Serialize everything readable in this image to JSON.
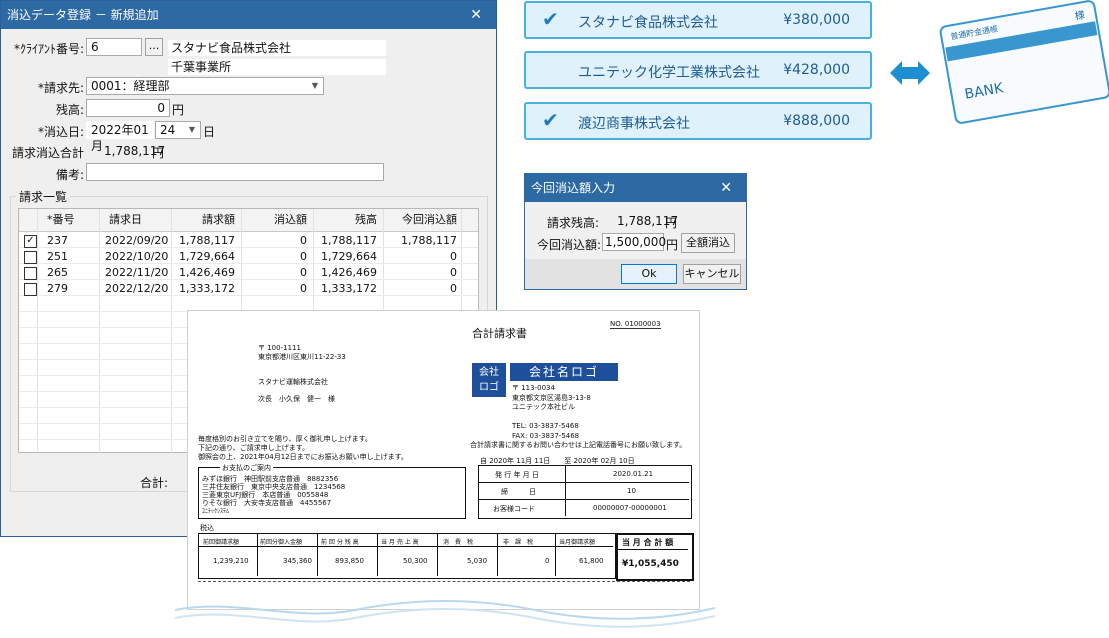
{
  "main_window": {
    "title": "消込データ登録 － 新規追加",
    "close": "✕",
    "client_label": "*ｸﾗｲｱﾝﾄ番号:",
    "client_number": "6",
    "browse_button": "...",
    "client_name": "スタナビ食品株式会社",
    "client_branch": "千葉事業所",
    "billing_label": "*請求先:",
    "billing_value": "0001：経理部",
    "balance_label": "残高:",
    "balance_value": "0",
    "yen": "円",
    "date_label": "*消込日:",
    "date_year_month": "2022年01月",
    "date_day": "24",
    "day_suffix": "日",
    "total_label": "請求消込合計",
    "total_value": "1,788,117",
    "total_yen": "円",
    "memo_label": "備考:",
    "memo_value": "",
    "list_title": "請求一覧",
    "columns": [
      "*番号",
      "請求日",
      "請求額",
      "消込額",
      "残高",
      "今回消込額"
    ],
    "rows": [
      {
        "checked": true,
        "no": "237",
        "date": "2022/09/20",
        "amount": "1,788,117",
        "applied": "0",
        "balance": "1,788,117",
        "current": "1,788,117"
      },
      {
        "checked": false,
        "no": "251",
        "date": "2022/10/20",
        "amount": "1,729,664",
        "applied": "0",
        "balance": "1,729,664",
        "current": "0"
      },
      {
        "checked": false,
        "no": "265",
        "date": "2022/11/20",
        "amount": "1,426,469",
        "applied": "0",
        "balance": "1,426,469",
        "current": "0"
      },
      {
        "checked": false,
        "no": "279",
        "date": "2022/12/20",
        "amount": "1,333,172",
        "applied": "0",
        "balance": "1,333,172",
        "current": "0"
      }
    ],
    "sum_label": "合計:"
  },
  "companies": [
    {
      "checked": true,
      "name": "スタナビ食品株式会社",
      "amount": "¥380,000"
    },
    {
      "checked": false,
      "name": "ユニテック化学工業株式会社",
      "amount": "¥428,000"
    },
    {
      "checked": true,
      "name": "渡辺商事株式会社",
      "amount": "¥888,000"
    }
  ],
  "bank_book": {
    "label": "普通貯金通帳",
    "stamp": "様",
    "bank": "BANK"
  },
  "dialog": {
    "title": "今回消込額入力",
    "close": "✕",
    "remaining_label": "請求残高:",
    "remaining_value": "1,788,117",
    "remaining_yen": "円",
    "current_label": "今回消込額:",
    "current_value": "1,500,000",
    "current_yen": "円",
    "full_button": "全額消込",
    "ok": "Ok",
    "cancel": "キャンセル"
  },
  "invoice": {
    "title": "合計請求書",
    "number": "NO. 01000003",
    "to_zip": "〒 100-1111",
    "to_address": "東京都港川区東川11-22-33",
    "to_company": "スタナビ運輸株式会社",
    "to_person": "次長　小久保　健一　様",
    "greeting_1": "毎度格別のお引き立てを賜り、厚く御礼申し上げます。",
    "greeting_2": "下記の通り、ご請求申し上げます。",
    "greeting_3": "御照会の上、2021年04月12日までにお振込お願い申し上げます。",
    "logo_left": "会社\nロゴ",
    "logo_right": "会社名ロゴ",
    "from_zip": "〒 113-0034",
    "from_address": "東京都文京区湯島3-13-8",
    "from_building": "ユニテック本社ビル",
    "tel": "TEL: 03-3837-5468",
    "fax": "FAX: 03-3837-5468",
    "inquiry": "合計請求書に関するお問い合わせは上記電話番号にお願い致します。",
    "bank_title": "お支払のご案内",
    "banks": [
      "みずほ銀行　神田駅前支店普通　8882356",
      "三井住友銀行　東京中央支店普通　1234568",
      "三菱東京UFJ銀行　本店普通　0055848",
      "りそな銀行　大安寺支店普通　4455567",
      "ﾕﾆﾃｯｸｼｽﾃﾑ"
    ],
    "period": "自 2020年 11月 11日　　至 2020年 02月 10日",
    "info_rows": [
      {
        "label": "発 行 年 月 日",
        "value": "2020.01.21"
      },
      {
        "label": "締　　　日",
        "value": "10"
      },
      {
        "label": "お客様コード",
        "value": "00000007-00000001"
      }
    ],
    "tax_note": "税込",
    "sum_headers": [
      "前回御請求額",
      "前回分御入金額",
      "前 回 分 残 高",
      "当 月 売 上 高",
      "消　費　税",
      "非　課　税",
      "当月御請求額"
    ],
    "sum_values": [
      "1,239,210",
      "345,360",
      "893,850",
      "50,300",
      "5,030",
      "0",
      "61,800"
    ],
    "grand_header": "当 月 合 計 額",
    "grand_value": "¥1,055,450"
  },
  "colors": {
    "accent": "#2d6aa3",
    "card_border": "#48b1dc",
    "card_bg": "#dff1fb",
    "card_text": "#1f5d92",
    "arrow": "#1d8fd1"
  }
}
